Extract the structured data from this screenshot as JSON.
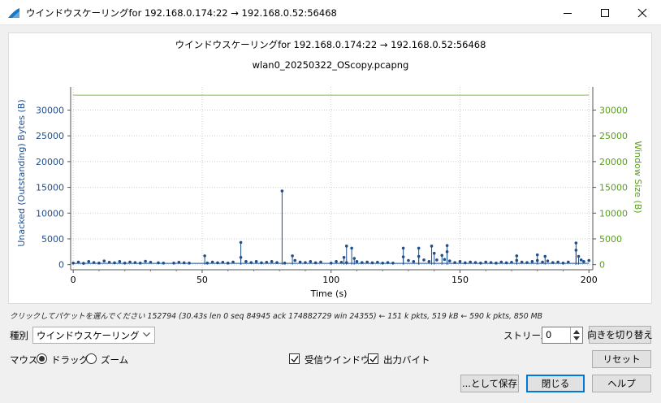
{
  "window": {
    "title": "ウインドウスケーリングfor 192.168.0.174:22 → 192.168.0.52:56468"
  },
  "chart_data": {
    "type": "scatter",
    "title": "ウインドウスケーリングfor 192.168.0.174:22 → 192.168.0.52:56468",
    "subtitle": "wlan0_20250322_OScopy.pcapng",
    "xlabel": "Time (s)",
    "ylabel": "Unacked (Outstanding) Bytes (B)",
    "y2label": "Window Size (B)",
    "xlim": [
      -1,
      201.5
    ],
    "ylim": [
      -1000,
      34500
    ],
    "xticks": [
      0,
      50,
      100,
      150,
      200
    ],
    "yticks": [
      0,
      5000,
      10000,
      15000,
      20000,
      25000,
      30000
    ],
    "grid": true,
    "series": [
      {
        "role": "unacked",
        "color": "#1f4e8c",
        "points": [
          [
            0,
            300
          ],
          [
            2,
            500
          ],
          [
            4,
            250
          ],
          [
            6,
            600
          ],
          [
            8,
            400
          ],
          [
            10,
            300
          ],
          [
            12,
            700
          ],
          [
            14,
            450
          ],
          [
            16,
            350
          ],
          [
            18,
            600
          ],
          [
            20,
            300
          ],
          [
            22,
            500
          ],
          [
            24,
            400
          ],
          [
            26,
            300
          ],
          [
            28,
            650
          ],
          [
            30,
            450
          ],
          [
            33,
            350
          ],
          [
            35,
            300
          ],
          [
            39,
            300
          ],
          [
            41,
            450
          ],
          [
            43,
            350
          ],
          [
            45,
            300
          ],
          [
            51,
            1700
          ],
          [
            52,
            300
          ],
          [
            54,
            500
          ],
          [
            56,
            350
          ],
          [
            58,
            450
          ],
          [
            60,
            300
          ],
          [
            62,
            500
          ],
          [
            65,
            4300
          ],
          [
            65,
            1400
          ],
          [
            67,
            600
          ],
          [
            69,
            400
          ],
          [
            71,
            600
          ],
          [
            73,
            350
          ],
          [
            75,
            450
          ],
          [
            77,
            600
          ],
          [
            79,
            400
          ],
          [
            81,
            14300
          ],
          [
            82,
            300
          ],
          [
            85,
            1700
          ],
          [
            86,
            800
          ],
          [
            88,
            500
          ],
          [
            90,
            400
          ],
          [
            92,
            600
          ],
          [
            94,
            350
          ],
          [
            96,
            500
          ],
          [
            100,
            300
          ],
          [
            102,
            600
          ],
          [
            104,
            450
          ],
          [
            105,
            1400
          ],
          [
            106,
            3600
          ],
          [
            106,
            400
          ],
          [
            108,
            3200
          ],
          [
            109,
            1200
          ],
          [
            110,
            600
          ],
          [
            112,
            400
          ],
          [
            114,
            500
          ],
          [
            116,
            350
          ],
          [
            118,
            450
          ],
          [
            120,
            300
          ],
          [
            122,
            400
          ],
          [
            124,
            300
          ],
          [
            128,
            3200
          ],
          [
            128,
            1500
          ],
          [
            130,
            800
          ],
          [
            132,
            600
          ],
          [
            134,
            3200
          ],
          [
            134,
            1600
          ],
          [
            136,
            900
          ],
          [
            138,
            600
          ],
          [
            139,
            3600
          ],
          [
            140,
            2200
          ],
          [
            141,
            900
          ],
          [
            143,
            1800
          ],
          [
            144,
            1000
          ],
          [
            145,
            3700
          ],
          [
            145,
            2500
          ],
          [
            146,
            700
          ],
          [
            148,
            400
          ],
          [
            150,
            600
          ],
          [
            152,
            350
          ],
          [
            154,
            500
          ],
          [
            156,
            400
          ],
          [
            158,
            300
          ],
          [
            160,
            500
          ],
          [
            162,
            400
          ],
          [
            164,
            300
          ],
          [
            166,
            500
          ],
          [
            168,
            350
          ],
          [
            170,
            450
          ],
          [
            172,
            1700
          ],
          [
            172,
            800
          ],
          [
            174,
            500
          ],
          [
            176,
            400
          ],
          [
            178,
            600
          ],
          [
            180,
            1900
          ],
          [
            180,
            800
          ],
          [
            182,
            500
          ],
          [
            183,
            1600
          ],
          [
            184,
            700
          ],
          [
            186,
            400
          ],
          [
            188,
            500
          ],
          [
            190,
            300
          ],
          [
            192,
            500
          ],
          [
            195,
            4200
          ],
          [
            195,
            2800
          ],
          [
            196,
            1600
          ],
          [
            197,
            900
          ],
          [
            198,
            600
          ],
          [
            200,
            800
          ]
        ]
      },
      {
        "role": "window-size",
        "color": "#7bc043",
        "points": [
          [
            0,
            32900
          ],
          [
            200,
            32900
          ]
        ]
      }
    ]
  },
  "status": {
    "text": "クリックしてパケットを選んでください 152794 (30.43s len 0 seq 84945 ack 174882729 win 24355) ← 151 k pkts, 519 kB ← 590 k pkts, 850 MB"
  },
  "controls": {
    "type_label": "種別",
    "type_value": "ウインドウスケーリング",
    "stream_label": "ストリーム",
    "stream_value": "0",
    "switch_direction": "向きを切り替え",
    "mouse_label": "マウス",
    "drag_label": "ドラッグ",
    "zoom_label": "ズーム",
    "recv_window_label": "受信ウインドウ",
    "out_bytes_label": "出力バイト",
    "reset": "リセット",
    "save_as": "...として保存",
    "close": "閉じる",
    "help": "ヘルプ"
  }
}
